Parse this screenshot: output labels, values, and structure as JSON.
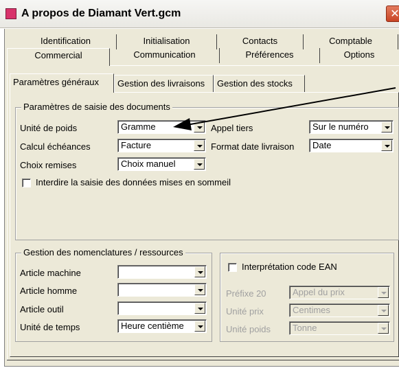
{
  "window": {
    "title": "A propos de Diamant Vert.gcm",
    "close_glyph": "✕"
  },
  "tabs_row1": [
    "Identification",
    "Initialisation",
    "Contacts",
    "Comptable"
  ],
  "tabs_row2": [
    "Commercial",
    "Communication",
    "Préférences",
    "Options"
  ],
  "subtabs": [
    "Paramètres généraux",
    "Gestion des livraisons",
    "Gestion des stocks"
  ],
  "saisie": {
    "legend": "Paramètres de saisie des documents",
    "unite_poids_label": "Unité de poids",
    "unite_poids_value": "Gramme",
    "calcul_label": "Calcul échéances",
    "calcul_value": "Facture",
    "choix_label": "Choix remises",
    "choix_value": "Choix manuel",
    "appel_label": "Appel tiers",
    "appel_value": "Sur le numéro",
    "format_label": "Format date livraison",
    "format_value": "Date",
    "interdire_label": "Interdire la saisie des données mises en sommeil"
  },
  "nomenclatures": {
    "legend": "Gestion des nomenclatures / ressources",
    "machine_label": "Article machine",
    "homme_label": "Article homme",
    "outil_label": "Article outil",
    "temps_label": "Unité de temps",
    "temps_value": "Heure centième"
  },
  "ean": {
    "checkbox_label": "Interprétation code EAN",
    "prefixe_label": "Préfixe 20",
    "prefixe_value": "Appel du prix",
    "prix_label": "Unité prix",
    "prix_value": "Centimes",
    "poids_label": "Unité poids",
    "poids_value": "Tonne"
  },
  "colors": {
    "face": "#ece9d8",
    "accent_icon": "#d8326a",
    "close": "#c84424"
  }
}
